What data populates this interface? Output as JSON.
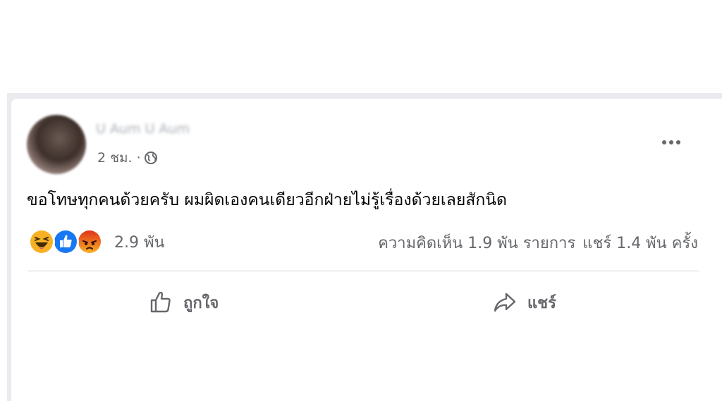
{
  "post": {
    "author": "U Aum U Aum",
    "time": "2 ชม.",
    "separator": "·",
    "text": "ขอโทษทุกคนด้วยครับ ผมผิดเองคนเดียวอีกฝ่ายไม่รู้เรื่องด้วยเลยสักนิด",
    "privacy_icon": "globe-icon",
    "menu_icon": "more-dots-icon"
  },
  "reactions": {
    "icons": [
      "haha-icon",
      "like-icon",
      "angry-icon"
    ],
    "count": "2.9 พัน"
  },
  "stats": {
    "comments": "ความคิดเห็น 1.9 พัน รายการ",
    "shares": "แชร์ 1.4 พัน ครั้ง"
  },
  "actions": {
    "like_label": "ถูกใจ",
    "share_label": "แชร์"
  },
  "colors": {
    "like_blue": "#1877f2",
    "haha_yellow": "#f7b125",
    "angry_orange": "#e9710f",
    "secondary_text": "#65676b"
  }
}
